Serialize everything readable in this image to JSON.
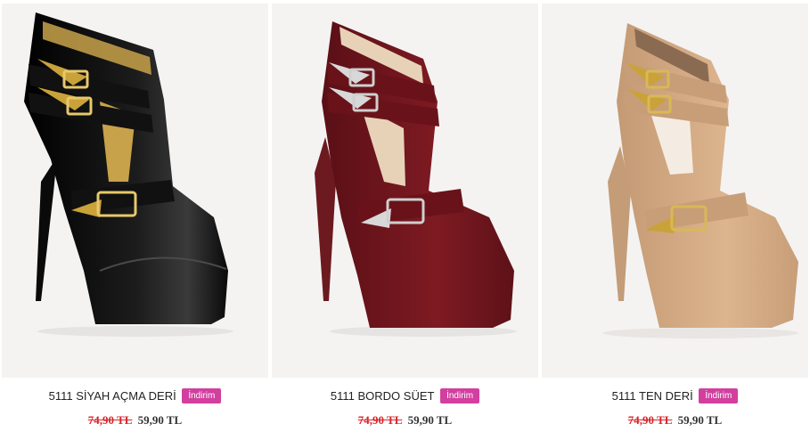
{
  "products": [
    {
      "name": "5111 SİYAH AÇMA DERİ",
      "badge": "İndirim",
      "old_price": "74,90 TL",
      "new_price": "59,90 TL",
      "image_icon": "black-patent-ankle-boot-image"
    },
    {
      "name": "5111 BORDO SÜET",
      "badge": "İndirim",
      "old_price": "74,90 TL",
      "new_price": "59,90 TL",
      "image_icon": "burgundy-suede-ankle-boot-image"
    },
    {
      "name": "5111 TEN DERİ",
      "badge": "İndirim",
      "old_price": "74,90 TL",
      "new_price": "59,90 TL",
      "image_icon": "nude-leather-ankle-boot-image"
    }
  ],
  "colors": {
    "badge_bg": "#d23f9f",
    "old_price": "#d9262b",
    "shoe_black": "#0d0d0d",
    "shoe_burgundy": "#7a1820",
    "shoe_nude": "#d9b08a",
    "buckle_gold": "#c9a23a",
    "buckle_silver": "#c8c8c8"
  }
}
